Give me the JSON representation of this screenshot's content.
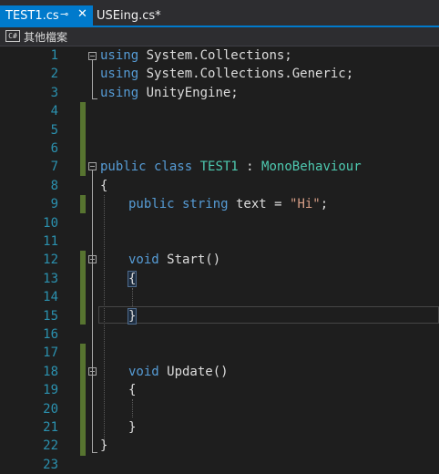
{
  "tabs": [
    {
      "label": "TEST1.cs",
      "active": true,
      "pin_icon": "pin-icon",
      "close_icon": "close-icon"
    },
    {
      "label": "USEing.cs*",
      "active": false
    }
  ],
  "navbar": {
    "icon": "C#",
    "label": "其他檔案"
  },
  "editor": {
    "lines": [
      {
        "n": "1"
      },
      {
        "n": "2"
      },
      {
        "n": "3"
      },
      {
        "n": "4"
      },
      {
        "n": "5"
      },
      {
        "n": "6"
      },
      {
        "n": "7"
      },
      {
        "n": "8"
      },
      {
        "n": "9"
      },
      {
        "n": "10"
      },
      {
        "n": "11"
      },
      {
        "n": "12"
      },
      {
        "n": "13"
      },
      {
        "n": "14"
      },
      {
        "n": "15"
      },
      {
        "n": "16"
      },
      {
        "n": "17"
      },
      {
        "n": "18"
      },
      {
        "n": "19"
      },
      {
        "n": "20"
      },
      {
        "n": "21"
      },
      {
        "n": "22"
      },
      {
        "n": "23"
      }
    ],
    "code": {
      "l1_kw": "using",
      "l1_rest": " System.Collections;",
      "l2_kw": "using",
      "l2_rest": " System.Collections.Generic;",
      "l3_kw": "using",
      "l3_rest": " UnityEngine;",
      "l7_kw": "public class",
      "l7_cls": "TEST1",
      "l7_colon": " : ",
      "l7_base": "MonoBehaviour",
      "l8": "{",
      "l9_kw": "public string",
      "l9_var": " text = ",
      "l9_str": "\"Hi\"",
      "l9_end": ";",
      "l12_kw": "void",
      "l12_rest": " Start()",
      "l13": "{",
      "l15": "}",
      "l18_kw": "void",
      "l18_rest": " Update()",
      "l19": "{",
      "l21": "}",
      "l22": "}"
    }
  },
  "colors": {
    "keyword": "#569cd6",
    "type": "#4ec9b0",
    "string": "#d69d85",
    "text": "#dcdcdc",
    "line_number": "#2b91af",
    "change_bar": "#577430",
    "tab_active": "#007acc"
  }
}
